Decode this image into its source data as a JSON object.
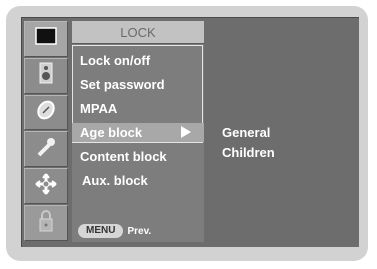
{
  "menu": {
    "title": "LOCK",
    "items": [
      {
        "label": "Lock on/off"
      },
      {
        "label": "Set password"
      },
      {
        "label": "MPAA"
      },
      {
        "label": "Age block",
        "selected": true
      },
      {
        "label": "Content block"
      },
      {
        "label": "Aux. block"
      }
    ]
  },
  "footer": {
    "menu_button": "MENU",
    "prev_label": "Prev."
  },
  "submenu": {
    "items": [
      {
        "label": "General"
      },
      {
        "label": "Children"
      }
    ]
  },
  "icons": [
    "screen-icon",
    "speaker-icon",
    "clock-icon",
    "option-icon",
    "setup-icon",
    "lock-icon"
  ],
  "colors": {
    "selected_bar": "#a8a8a8",
    "title_bar": "#c2c2c2",
    "screen_bg": "#6d6d6d"
  }
}
